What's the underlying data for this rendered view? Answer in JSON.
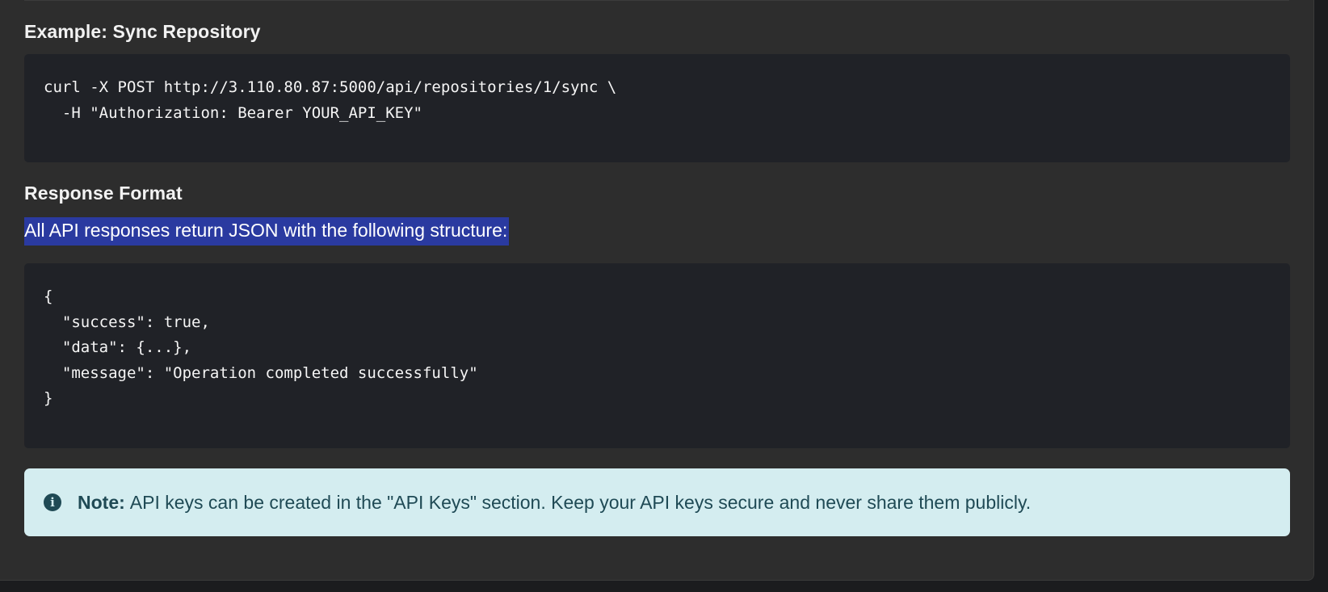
{
  "sections": {
    "sync_example": {
      "heading": "Example: Sync Repository",
      "code": "curl -X POST http://3.110.80.87:5000/api/repositories/1/sync \\\n  -H \"Authorization: Bearer YOUR_API_KEY\""
    },
    "response_format": {
      "heading": "Response Format",
      "intro": "All API responses return JSON with the following structure:",
      "code": "{\n  \"success\": true,\n  \"data\": {...},\n  \"message\": \"Operation completed successfully\"\n}"
    }
  },
  "note": {
    "icon": "info-circle-icon",
    "label": "Note:",
    "text": "API keys can be created in the \"API Keys\" section. Keep your API keys secure and never share them publicly."
  },
  "colors": {
    "page_background": "#2d2d2d",
    "code_background": "#202227",
    "selection_highlight": "#2a3aa0",
    "note_background": "#d4edf0",
    "note_text": "#1f4a55"
  }
}
